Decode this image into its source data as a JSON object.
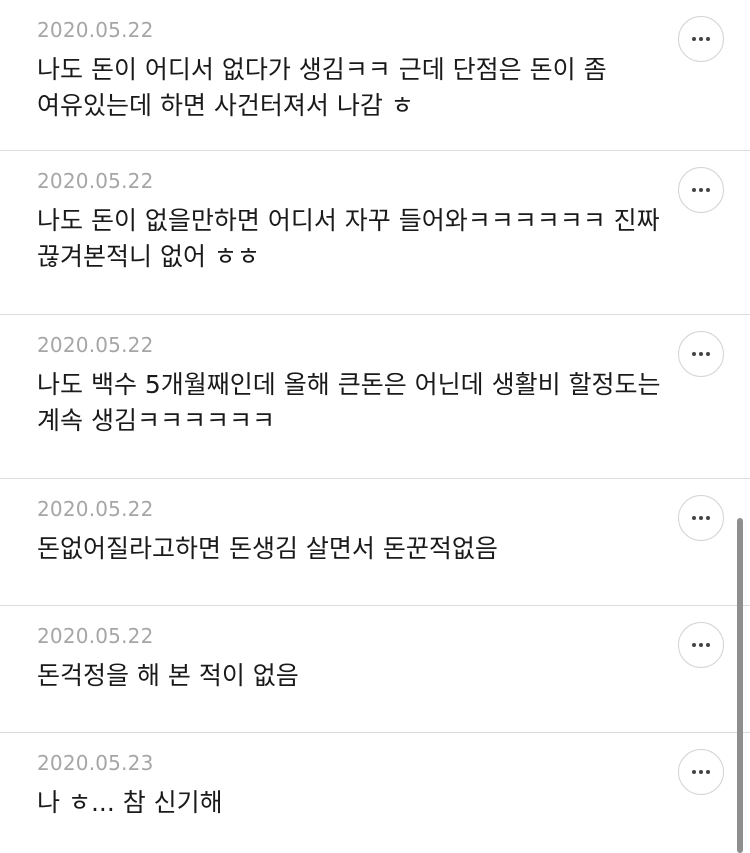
{
  "comments": [
    {
      "date": "2020.05.22",
      "text": "나도 돈이 어디서 없다가 생김ㅋㅋ 근데 단점은 돈이 좀 여유있는데 하면 사건터져서 나감 ㅎ",
      "more_icon": "more-horizontal-icon"
    },
    {
      "date": "2020.05.22",
      "text": "나도 돈이 없을만하면 어디서 자꾸 들어와ㅋㅋㅋㅋㅋㅋ 진짜 끊겨본적니 없어 ㅎㅎ",
      "more_icon": "more-horizontal-icon"
    },
    {
      "date": "2020.05.22",
      "text": "나도 백수 5개월째인데 올해 큰돈은 어닌데 생활비 할정도는 계속 생김ㅋㅋㅋㅋㅋㅋ",
      "more_icon": "more-horizontal-icon"
    },
    {
      "date": "2020.05.22",
      "text": "돈없어질라고하면 돈생김 살면서 돈꾼적없음",
      "more_icon": "more-horizontal-icon"
    },
    {
      "date": "2020.05.22",
      "text": "돈걱정을 해 본 적이 없음",
      "more_icon": "more-horizontal-icon"
    },
    {
      "date": "2020.05.23",
      "text": "나 ㅎ... 참 신기해",
      "more_icon": "more-horizontal-icon"
    }
  ],
  "colors": {
    "date": "#a6a6a6",
    "text": "#1a1a1a",
    "divider": "#dcdcdc",
    "scrollbar": "#8e8e8e"
  }
}
